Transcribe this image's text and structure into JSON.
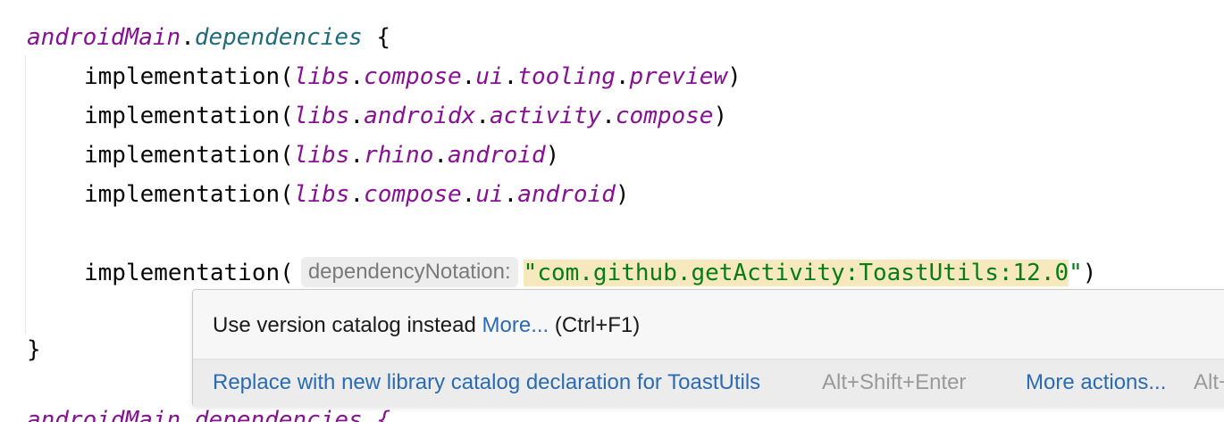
{
  "editor": {
    "line1": {
      "receiver": "androidMain",
      "dot": ".",
      "member": "dependencies",
      "brace": " {"
    },
    "deps": [
      {
        "fn": "implementation",
        "open": "(",
        "parts": [
          "libs",
          ".",
          "compose",
          ".",
          "ui",
          ".",
          "tooling",
          ".",
          "preview"
        ],
        "close": ")"
      },
      {
        "fn": "implementation",
        "open": "(",
        "parts": [
          "libs",
          ".",
          "androidx",
          ".",
          "activity",
          ".",
          "compose"
        ],
        "close": ")"
      },
      {
        "fn": "implementation",
        "open": "(",
        "parts": [
          "libs",
          ".",
          "rhino",
          ".",
          "android"
        ],
        "close": ")"
      },
      {
        "fn": "implementation",
        "open": "(",
        "parts": [
          "libs",
          ".",
          "compose",
          ".",
          "ui",
          ".",
          "android"
        ],
        "close": ")"
      }
    ],
    "last_dep": {
      "fn": "implementation",
      "open": "(",
      "param_hint": "dependencyNotation:",
      "quote_open": "\"",
      "value": "com.github.getActivity:ToastUtils:12.0",
      "quote_close": "\"",
      "close": ")"
    },
    "closing_brace": "}",
    "partial_next_line": "androidMain.dependencies {"
  },
  "popup": {
    "message": "Use version catalog instead",
    "more_link": "More...",
    "shortcut": "(Ctrl+F1)",
    "fix_action": "Replace with new library catalog declaration for ToastUtils",
    "fix_shortcut": "Alt+Shift+Enter",
    "more_actions": "More actions...",
    "more_actions_shortcut": "Alt+Enter"
  },
  "colors": {
    "keyword_purple": "#871094",
    "extension_teal": "#1f6b7a",
    "string_green": "#067d17",
    "string_highlight": "#f7e8bd",
    "link_blue": "#2a6bb3"
  }
}
